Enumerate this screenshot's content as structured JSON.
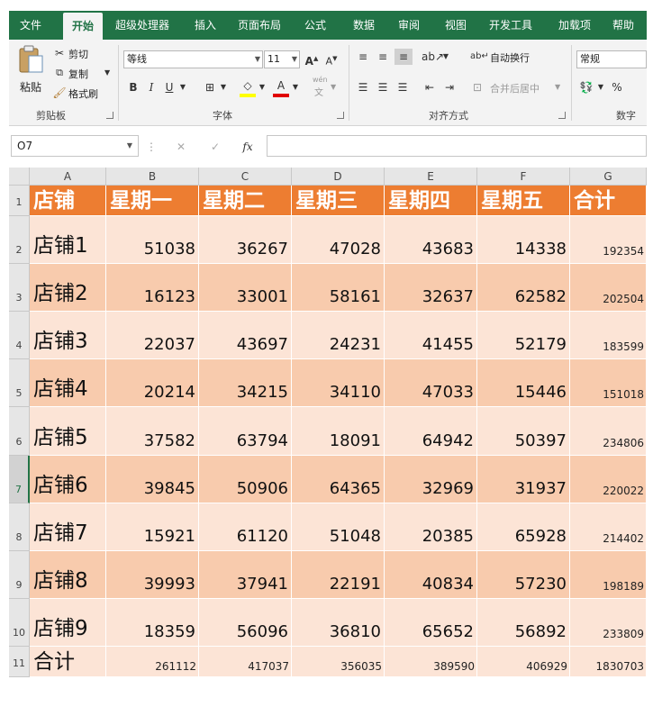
{
  "ribbon": {
    "tabs": [
      "文件",
      "开始",
      "超级处理器",
      "插入",
      "页面布局",
      "公式",
      "数据",
      "审阅",
      "视图",
      "开发工具",
      "加载项",
      "帮助"
    ],
    "active_tab": "开始",
    "clipboard": {
      "paste": "粘贴",
      "cut": "剪切",
      "copy": "复制",
      "format_painter": "格式刷",
      "group": "剪贴板"
    },
    "font": {
      "name": "等线",
      "size": "11",
      "group": "字体",
      "phonetic": "wén",
      "phonetic_char": "文"
    },
    "alignment": {
      "wrap": "自动换行",
      "merge": "合并后居中",
      "group": "对齐方式"
    },
    "number": {
      "format": "常规",
      "group": "数字"
    }
  },
  "formula_bar": {
    "name_box": "O7",
    "fx": "fx",
    "content": ""
  },
  "sheet": {
    "columns": [
      "A",
      "B",
      "C",
      "D",
      "E",
      "F",
      "G"
    ],
    "row_numbers": [
      "1",
      "2",
      "3",
      "4",
      "5",
      "6",
      "7",
      "8",
      "9",
      "10",
      "11"
    ],
    "header_row": [
      "店铺",
      "星期一",
      "星期二",
      "星期三",
      "星期四",
      "星期五",
      "合计"
    ],
    "data_rows": [
      [
        "店铺1",
        "51038",
        "36267",
        "47028",
        "43683",
        "14338",
        "192354"
      ],
      [
        "店铺2",
        "16123",
        "33001",
        "58161",
        "32637",
        "62582",
        "202504"
      ],
      [
        "店铺3",
        "22037",
        "43697",
        "24231",
        "41455",
        "52179",
        "183599"
      ],
      [
        "店铺4",
        "20214",
        "34215",
        "34110",
        "47033",
        "15446",
        "151018"
      ],
      [
        "店铺5",
        "37582",
        "63794",
        "18091",
        "64942",
        "50397",
        "234806"
      ],
      [
        "店铺6",
        "39845",
        "50906",
        "64365",
        "32969",
        "31937",
        "220022"
      ],
      [
        "店铺7",
        "15921",
        "61120",
        "51048",
        "20385",
        "65928",
        "214402"
      ],
      [
        "店铺8",
        "39993",
        "37941",
        "22191",
        "40834",
        "57230",
        "198189"
      ],
      [
        "店铺9",
        "18359",
        "56096",
        "36810",
        "65652",
        "56892",
        "233809"
      ]
    ],
    "total_row": [
      "合计",
      "261112",
      "417037",
      "356035",
      "389590",
      "406929",
      "1830703"
    ]
  },
  "colors": {
    "header": "#ED7D31",
    "band_dark": "#F8CBAD",
    "band_light": "#FCE4D6",
    "ribbon": "#217346"
  }
}
